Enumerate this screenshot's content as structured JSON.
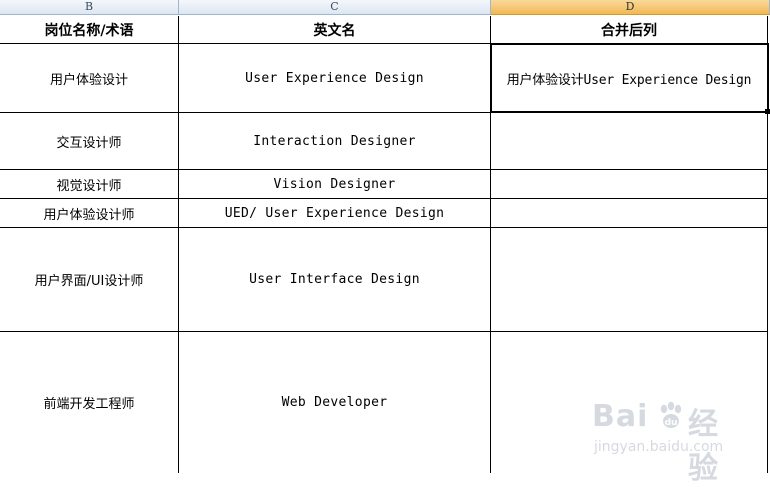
{
  "columns": [
    "B",
    "C",
    "D"
  ],
  "active_column": "D",
  "header": {
    "b": "岗位名称/术语",
    "c": "英文名",
    "d": "合并后列"
  },
  "rows": [
    {
      "b": "用户体验设计",
      "c": "User Experience Design",
      "d": "用户体验设计User Experience Design"
    },
    {
      "b": "交互设计师",
      "c": "Interaction Designer",
      "d": ""
    },
    {
      "b": "视觉设计师",
      "c": "Vision Designer",
      "d": ""
    },
    {
      "b": "用户体验设计师",
      "c": "UED/ User Experience Design",
      "d": ""
    },
    {
      "b": "用户界面/UI设计师",
      "c": "User Interface Design",
      "d": ""
    },
    {
      "b": "前端开发工程师",
      "c": "Web Developer",
      "d": ""
    }
  ],
  "watermark": {
    "brand_left": "Bai",
    "brand_right": "经验",
    "url": "jingyan.baidu.com"
  },
  "colors": {
    "grid": "#000000",
    "header_bg": "#dde6f1",
    "active_header_bg": "#f1b855"
  }
}
